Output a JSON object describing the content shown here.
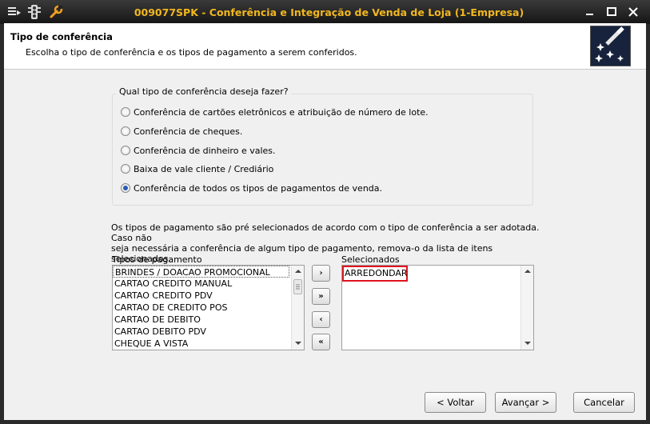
{
  "window": {
    "title": "009077SPK - Conferência e Integração de Venda de Loja (1-Empresa)",
    "accent_color": "#f2b71f",
    "icons": [
      "menu-icon",
      "traffic-light-icon",
      "wrench-icon"
    ]
  },
  "header": {
    "title": "Tipo de conferência",
    "subtitle": "Escolha o tipo de conferência e os tipos de pagamento a serem conferidos."
  },
  "group": {
    "title": "Qual tipo de conferência deseja fazer?",
    "options": [
      {
        "label": "Conferência de cartões eletrônicos e atribuição de número de lote.",
        "checked": false
      },
      {
        "label": "Conferência de cheques.",
        "checked": false
      },
      {
        "label": "Conferência de dinheiro e vales.",
        "checked": false
      },
      {
        "label": "Baixa de vale cliente / Crediário",
        "checked": false
      },
      {
        "label": "Conferência de todos os tipos de pagamentos de venda.",
        "checked": true
      }
    ]
  },
  "info": {
    "line1": "Os tipos de pagamento são pré selecionados de acordo com o tipo de conferência a ser adotada. Caso não",
    "line2": "seja necessária a conferência de algum tipo de pagamento, remova-o da lista de itens selecionados."
  },
  "available": {
    "label": "Tipos de pagamento",
    "items": [
      "BRINDES / DOACAO PROMOCIONAL",
      "CARTAO CREDITO MANUAL",
      "CARTAO CREDITO PDV",
      "CARTAO DE CREDITO POS",
      "CARTAO DE DEBITO",
      "CARTAO DEBITO PDV",
      "CHEQUE A VISTA"
    ]
  },
  "selected": {
    "label": "Selecionados",
    "items": [
      "ARREDONDAR"
    ]
  },
  "buttons": {
    "add_one": "›",
    "add_all": "»",
    "remove_one": "‹",
    "remove_all": "«",
    "back": "< Voltar",
    "next": "Avançar >",
    "cancel": "Cancelar"
  }
}
